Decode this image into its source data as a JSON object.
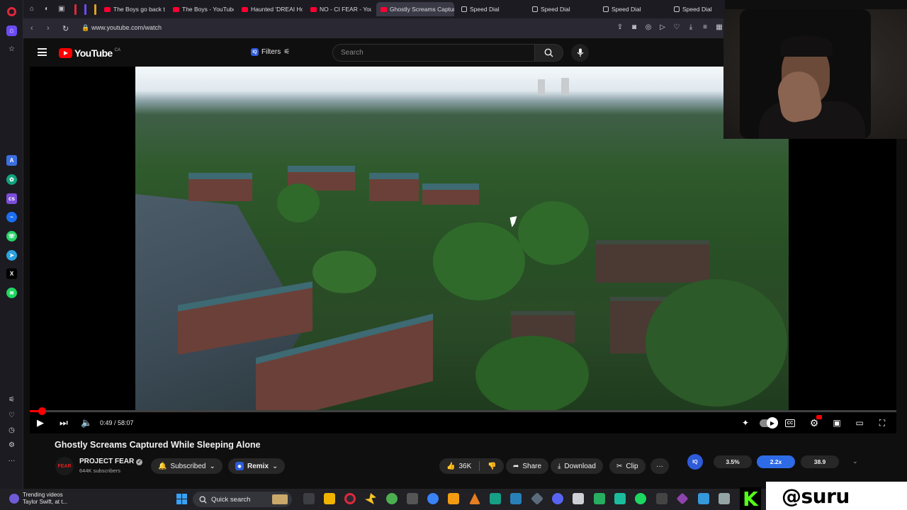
{
  "browser": {
    "tabs": [
      {
        "label": "The Boys go back to t",
        "favicon": "youtube-icon"
      },
      {
        "label": "The Boys - YouTube",
        "favicon": "youtube-icon"
      },
      {
        "label": "Haunted 'DREAI Hou",
        "favicon": "youtube-icon"
      },
      {
        "label": "NO - CI FEAR - YouT",
        "favicon": "youtube-icon"
      },
      {
        "label": "Ghostly Screams Capture",
        "favicon": "youtube-icon",
        "active": true
      },
      {
        "label": "Speed Dial",
        "favicon": "speed-dial-icon"
      },
      {
        "label": "Speed Dial",
        "favicon": "speed-dial-icon"
      },
      {
        "label": "Speed Dial",
        "favicon": "speed-dial-icon"
      },
      {
        "label": "Speed Dial",
        "favicon": "speed-dial-icon"
      }
    ],
    "url": "www.youtube.com/watch"
  },
  "youtube": {
    "logo_text": "YouTube",
    "country_code": "CA",
    "filters_label": "Filters",
    "iq_badge": "IQ",
    "search_placeholder": "Search"
  },
  "player": {
    "time_current": "0:49",
    "time_total": "58:07",
    "time_display": "0:49 / 58:07",
    "progress_fraction": 0.014
  },
  "video": {
    "title": "Ghostly Screams Captured While Sleeping Alone",
    "channel_name": "PROJECT FEAR",
    "channel_avatar_text": "FEAR",
    "subscribers": "644K subscribers",
    "subscribed_label": "Subscribed",
    "remix_label": "Remix",
    "likes": "36K",
    "share_label": "Share",
    "download_label": "Download",
    "clip_label": "Clip",
    "more_label": "···"
  },
  "extension": {
    "badge": "IQ",
    "stats": [
      "3.5%",
      "2.2x",
      "38.9"
    ]
  },
  "taskbar": {
    "weather_line1": "Trending videos",
    "weather_line2": "Taylor Swift, at t...",
    "search_label": "Quick search"
  },
  "overlay": {
    "brand_letter": "K",
    "handle": "@suru"
  },
  "colors": {
    "youtube_red": "#ff0000",
    "opera_red": "#e0283b",
    "iq_blue": "#2e5bd9",
    "kick_green": "#53fc18"
  }
}
